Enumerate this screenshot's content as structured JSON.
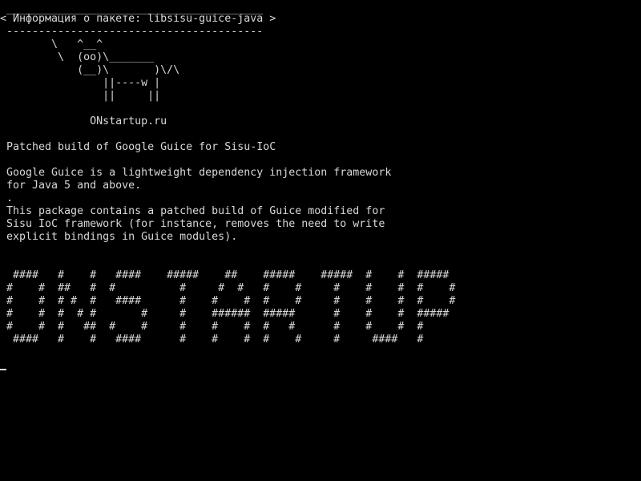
{
  "terminal": {
    "lines": [
      " ________________________________________",
      "< Информация о пакете: libsisu-guice-java >",
      " ----------------------------------------",
      "        \\   ^__^",
      "         \\  (oo)\\_______",
      "            (__)\\       )\\/\\",
      "                ||----w |",
      "                ||     ||",
      "",
      "              ONstartup.ru",
      "",
      " Patched build of Google Guice for Sisu-IoC",
      "",
      " Google Guice is a lightweight dependency injection framework",
      " for Java 5 and above.",
      " .",
      " This package contains a patched build of Guice modified for",
      " Sisu IoC framework (for instance, removes the need to write",
      " explicit bindings in Guice modules).",
      "",
      "",
      "  ####   #    #   ####    #####    ##    #####    #####  #    #  #####",
      " #    #  ##   #  #          #     #  #   #    #     #    #    #  #    #",
      " #    #  # #  #   ####      #    #    #  #    #     #    #    #  #    #",
      " #    #  #  # #       #     #    ######  #####      #    #    #  #####",
      " #    #  #   ##  #    #     #    #    #  #   #      #    #    #  #",
      "  ####   #    #   ####      #    #    #  #    #     #     ####   #"
    ]
  }
}
